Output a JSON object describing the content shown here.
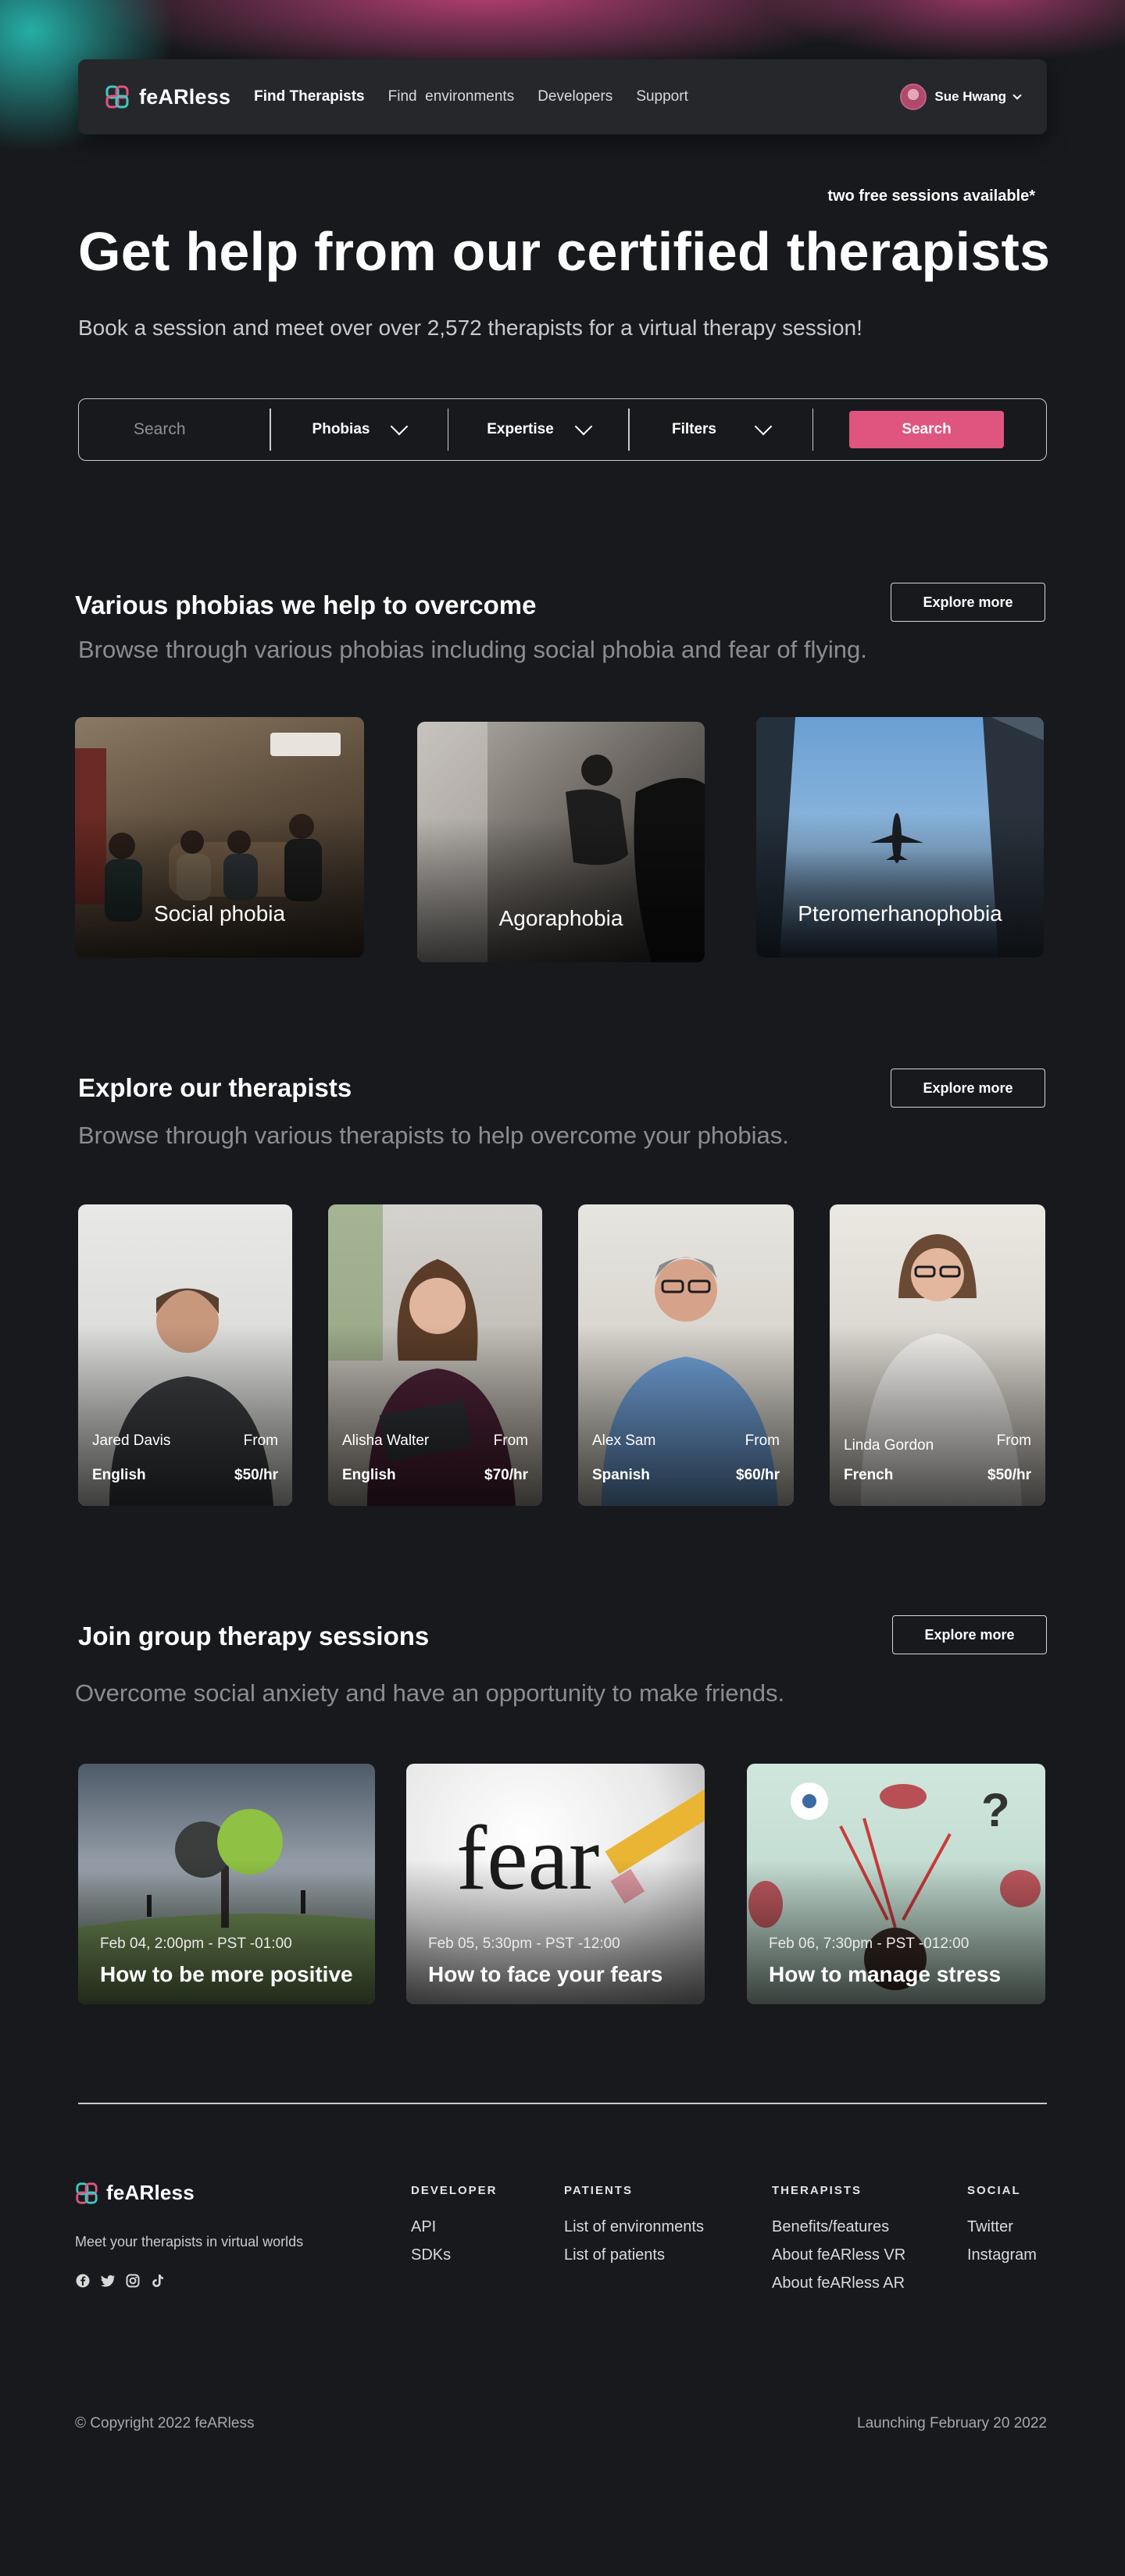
{
  "brand": {
    "name": "feARless"
  },
  "nav": {
    "links": [
      "Find Therapists",
      "Find  environments",
      "Developers",
      "Support"
    ],
    "user_name": "Sue Hwang"
  },
  "hero": {
    "badge": "two free sessions available*",
    "title": "Get help from our certified therapists",
    "subtitle": "Book a session and meet over over 2,572 therapists for a virtual therapy session!"
  },
  "search": {
    "placeholder": "Search",
    "phobias_label": "Phobias",
    "expertise_label": "Expertise",
    "filters_label": "Filters",
    "button_label": "Search"
  },
  "phobias": {
    "title": "Various phobias we help to overcome",
    "subtitle": "Browse through various phobias including social phobia and fear of flying.",
    "explore_label": "Explore more",
    "items": [
      {
        "label": "Social phobia"
      },
      {
        "label": "Agoraphobia"
      },
      {
        "label": "Pteromerhanophobia"
      }
    ]
  },
  "therapists": {
    "title": "Explore our therapists",
    "subtitle": "Browse through various therapists to help overcome your phobias.",
    "explore_label": "Explore more",
    "items": [
      {
        "name": "Jared Davis",
        "from": "From",
        "language": "English",
        "rate": "$50/hr"
      },
      {
        "name": "Alisha Walter",
        "from": "From",
        "language": "English",
        "rate": "$70/hr"
      },
      {
        "name": "Alex Sam",
        "from": "From",
        "language": "Spanish",
        "rate": "$60/hr"
      },
      {
        "name": "Linda Gordon",
        "from": "From",
        "language": "French",
        "rate": "$50/hr"
      }
    ]
  },
  "sessions": {
    "title": "Join group therapy sessions",
    "subtitle": "Overcome social anxiety and have an opportunity to make friends.",
    "explore_label": "Explore more",
    "items": [
      {
        "date": "Feb 04, 2:00pm - PST -01:00",
        "title": "How to be more positive"
      },
      {
        "date": "Feb 05, 5:30pm - PST -12:00",
        "title": "How to face your fears"
      },
      {
        "date": "Feb 06, 7:30pm - PST -012:00",
        "title": "How to manage stress"
      }
    ]
  },
  "footer": {
    "tagline": "Meet your therapists in virtual worlds",
    "columns": [
      {
        "heading": "DEVELOPER",
        "links": [
          "API",
          "SDKs"
        ]
      },
      {
        "heading": "PATIENTS",
        "links": [
          "List of environments",
          "List of patients"
        ]
      },
      {
        "heading": "THERAPISTS",
        "links": [
          "Benefits/features",
          "About feARless VR",
          "About feARless AR"
        ]
      },
      {
        "heading": "SOCIAL",
        "links": [
          "Twitter",
          "Instagram"
        ]
      }
    ],
    "social_icons": [
      "facebook-icon",
      "twitter-icon",
      "instagram-icon",
      "tiktok-icon"
    ],
    "copyright": "© Copyright 2022 feARless",
    "launch": "Launching February 20 2022"
  },
  "colors": {
    "accent": "#e0557f",
    "background": "#17191d",
    "nav": "#25272b"
  }
}
